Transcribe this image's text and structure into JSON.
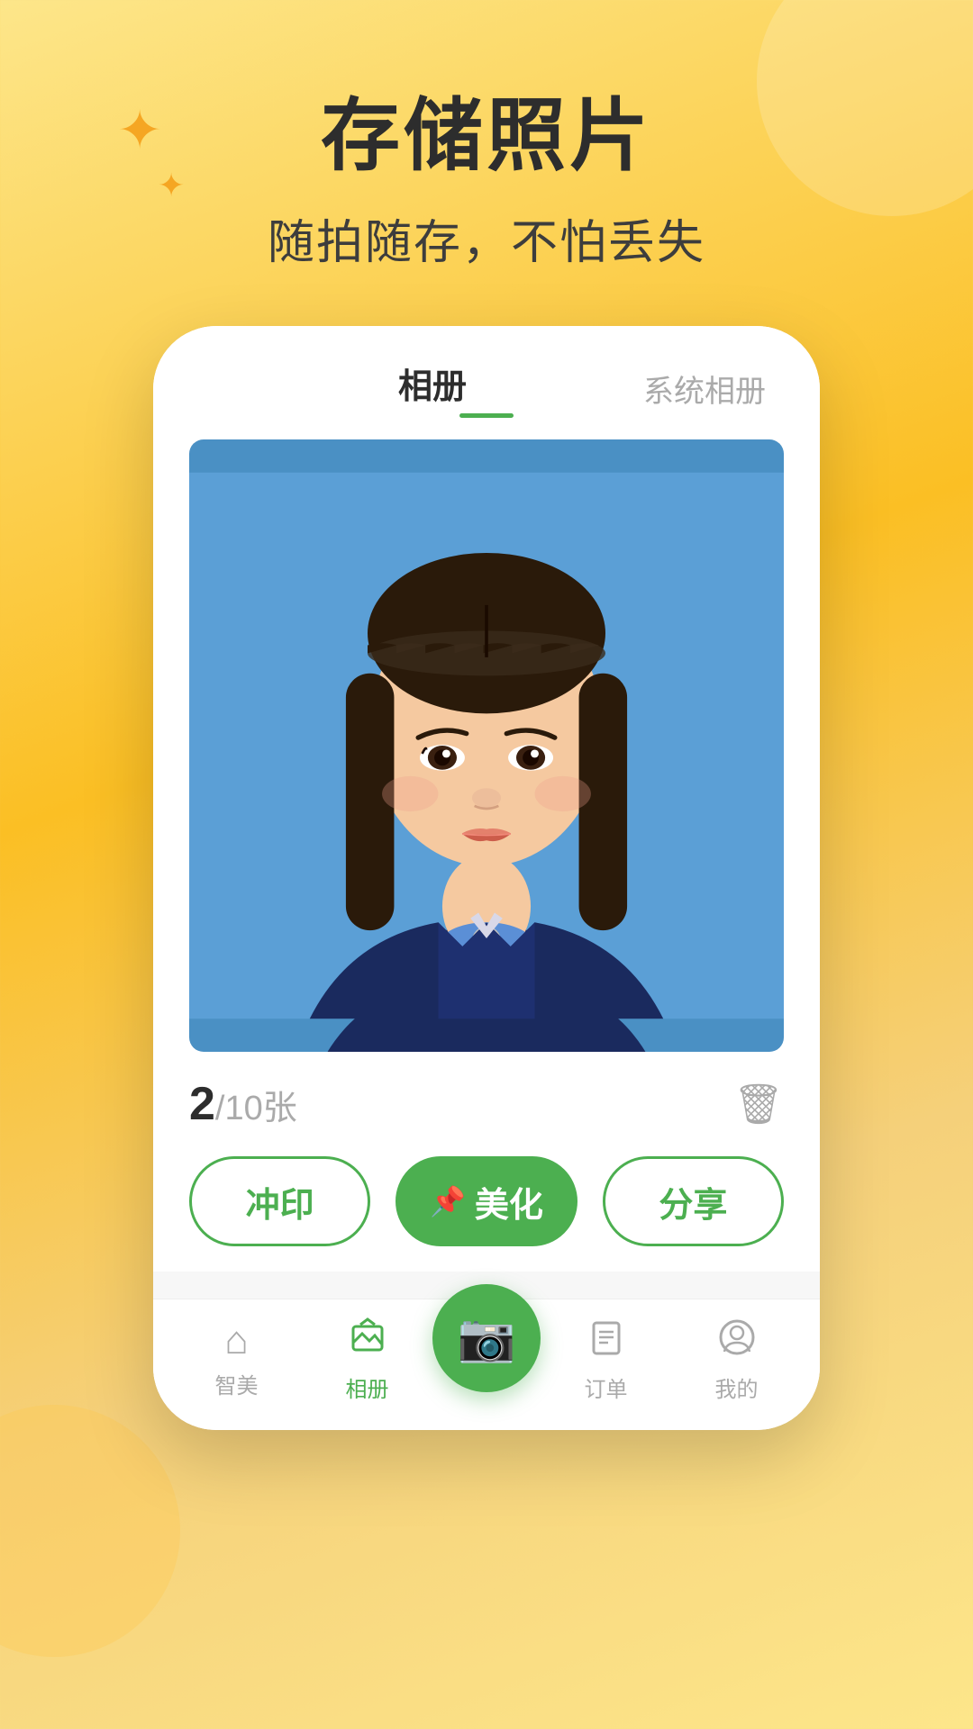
{
  "background": {
    "color_start": "#fde68a",
    "color_end": "#fbbf24"
  },
  "header": {
    "main_title": "存储照片",
    "sub_title": "随拍随存，不怕丢失"
  },
  "app": {
    "tab_album": "相册",
    "tab_system": "系统相册",
    "photo_current": "2",
    "photo_slash": "/",
    "photo_total": "10张",
    "btn_print": "冲印",
    "btn_beautify": "美化",
    "btn_beautify_icon": "📌",
    "btn_share": "分享",
    "nav_items": [
      {
        "label": "智美",
        "icon": "⌂",
        "active": false
      },
      {
        "label": "相册",
        "icon": "▲",
        "active": true
      },
      {
        "label": "订单",
        "icon": "☰",
        "active": false
      },
      {
        "label": "我的",
        "icon": "○",
        "active": false
      }
    ],
    "camera_label": "camera"
  }
}
